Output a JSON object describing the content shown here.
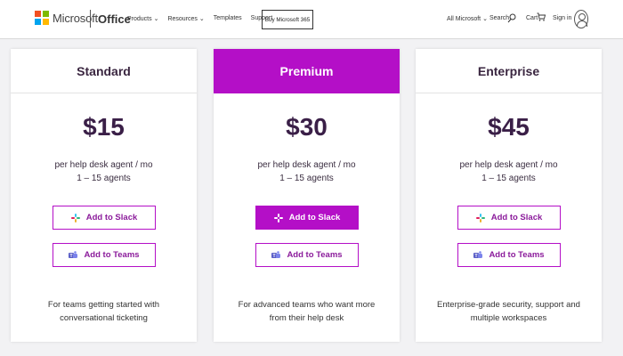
{
  "header": {
    "brand": "Microsoft",
    "product": "Office",
    "nav": [
      {
        "label": "Products",
        "dropdown": true
      },
      {
        "label": "Resources",
        "dropdown": true
      },
      {
        "label": "Templates",
        "dropdown": false
      },
      {
        "label": "Support",
        "dropdown": false
      }
    ],
    "buy_button": "Buy Microsoft 365",
    "all_microsoft": "All Microsoft",
    "search": "Search",
    "cart": "Cart",
    "signin": "Sign in"
  },
  "colors": {
    "accent": "#b40fc7",
    "accent_text": "#8b1b9b",
    "logo": [
      "#f25022",
      "#7fba00",
      "#00a4ef",
      "#ffb900"
    ]
  },
  "plans": [
    {
      "name": "Standard",
      "price": "$15",
      "unit": "per help desk agent / mo",
      "agents": "1 – 15 agents",
      "slack_label": "Add to Slack",
      "teams_label": "Add to Teams",
      "description_line1": "For teams getting started with",
      "description_line2": "conversational ticketing",
      "highlighted": false
    },
    {
      "name": "Premium",
      "price": "$30",
      "unit": "per help desk agent / mo",
      "agents": "1 – 15 agents",
      "slack_label": "Add to Slack",
      "teams_label": "Add to Teams",
      "description_line1": "For advanced teams who want more",
      "description_line2": "from their help desk",
      "highlighted": true
    },
    {
      "name": "Enterprise",
      "price": "$45",
      "unit": "per help desk agent / mo",
      "agents": "1 – 15 agents",
      "slack_label": "Add to Slack",
      "teams_label": "Add to Teams",
      "description_line1": "Enterprise-grade security, support and",
      "description_line2": "multiple workspaces",
      "highlighted": false
    }
  ],
  "icons": {
    "slack": "slack-icon",
    "teams": "teams-icon",
    "search": "search-icon",
    "cart": "cart-icon",
    "account": "account-icon",
    "chevron": "chevron-down-icon"
  }
}
